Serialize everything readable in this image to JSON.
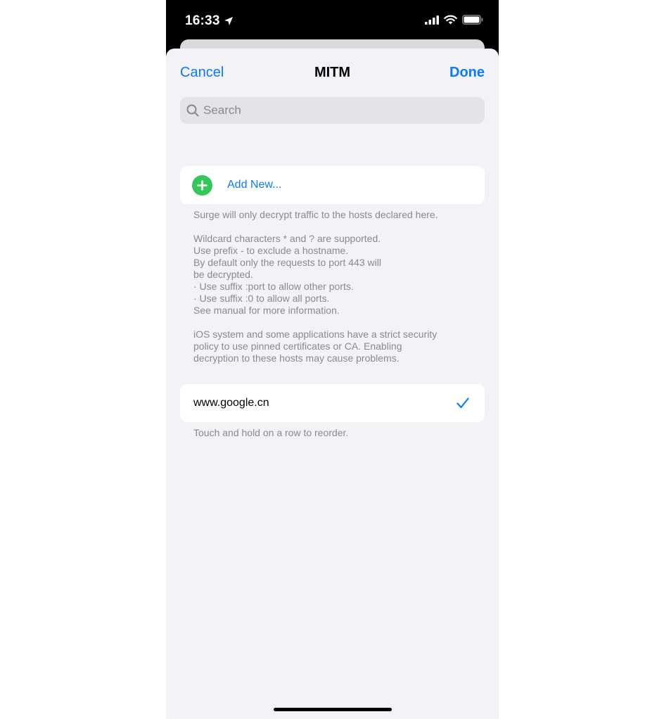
{
  "status_bar": {
    "time": "16:33",
    "location_icon": "location-arrow-icon",
    "signal_icon": "cellular-signal-icon",
    "wifi_icon": "wifi-icon",
    "battery_icon": "battery-icon"
  },
  "nav": {
    "cancel_label": "Cancel",
    "title": "MITM",
    "done_label": "Done"
  },
  "search": {
    "placeholder": "Search",
    "icon": "search-icon"
  },
  "add_new": {
    "label": "Add New...",
    "icon": "plus-circle-icon"
  },
  "info_footer": {
    "paragraph1": "Surge will only decrypt traffic to the hosts declared here.",
    "paragraph2": "Wildcard characters * and ? are supported.\nUse prefix - to exclude a hostname.\nBy default only the requests to port 443 will\nbe decrypted.\n · Use suffix :port to allow other ports.\n · Use suffix :0 to allow all ports.\nSee manual for more information.",
    "paragraph3": "iOS system and some applications have a strict security\npolicy to use pinned certificates or CA. Enabling\ndecryption to these hosts may cause problems."
  },
  "hosts": [
    {
      "hostname": "www.google.cn",
      "enabled": true
    }
  ],
  "reorder_hint": "Touch and hold on a row to reorder.",
  "colors": {
    "accent": "#0a7aff",
    "add_green": "#34c759",
    "background": "#f2f2f7",
    "secondary_text": "#8a8a8e"
  }
}
